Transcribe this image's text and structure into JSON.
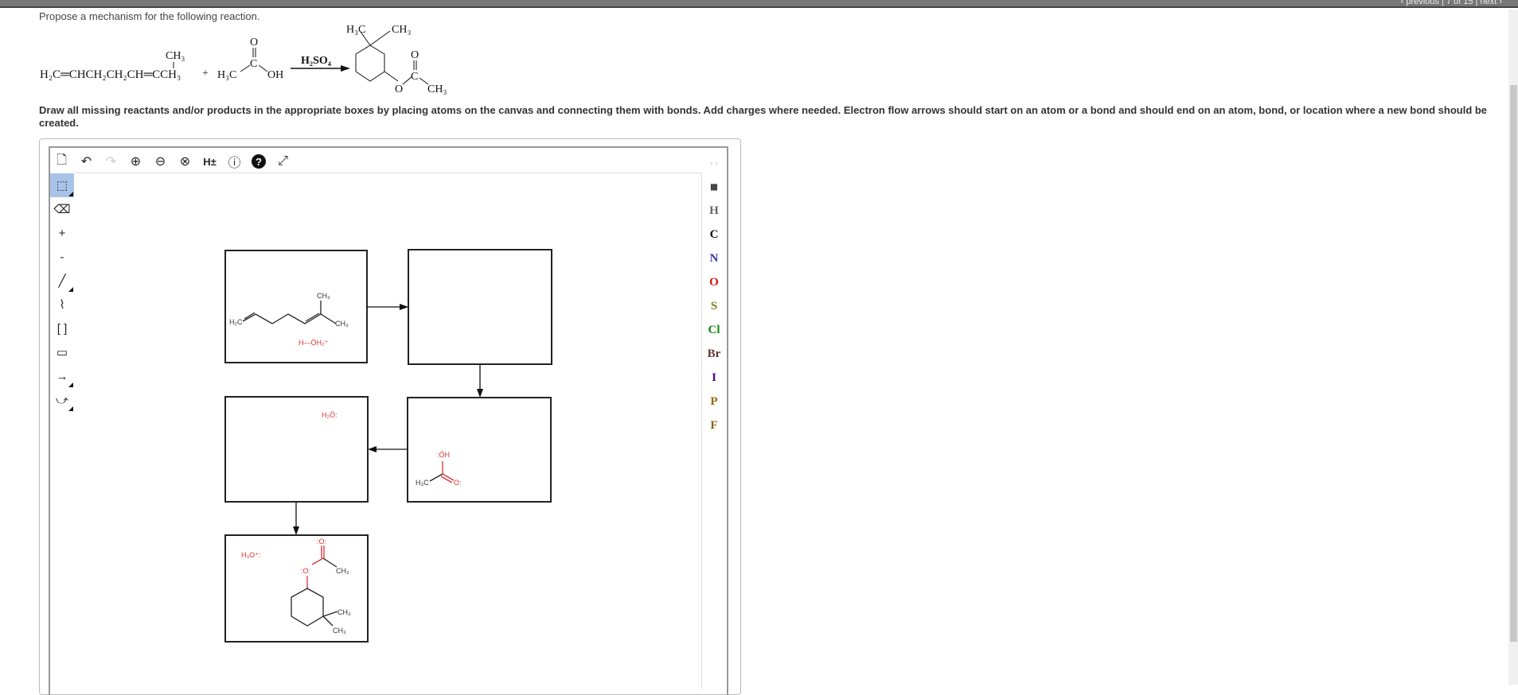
{
  "header": {
    "nav": "‹ previous | 7 of 15 | next ›"
  },
  "question": {
    "prompt": "Propose a mechanism for the following reaction.",
    "reactant1": "H₂C═CHCH₂CH₂CH═CCH₃",
    "reactant1_branch": "CH₃",
    "plus": "+",
    "reactant2_left": "H₃C",
    "reactant2_c": "C",
    "reactant2_o": "O",
    "reactant2_oh": "OH",
    "reagent": "H₂SO₄",
    "product_h3c": "H₃C",
    "product_ch3a": "CH₃",
    "product_o": "O",
    "product_c": "C",
    "product_o_ester": "O",
    "product_ch3b": "CH₃",
    "instructions": "Draw all missing reactants and/or products in the appropriate boxes by placing atoms on the canvas and connecting them with bonds. Add charges where needed. Electron flow arrows should start on an atom or a bond and should end on an atom, bond, or location where a new bond should be created."
  },
  "toolbar": {
    "items": [
      {
        "name": "new-document-icon",
        "glyph": "🗋"
      },
      {
        "name": "undo-icon",
        "glyph": "↶"
      },
      {
        "name": "redo-icon",
        "glyph": "↷"
      },
      {
        "name": "zoom-in-icon",
        "glyph": "⊕"
      },
      {
        "name": "zoom-out-icon",
        "glyph": "⊖"
      },
      {
        "name": "zoom-reset-icon",
        "glyph": "⊗"
      },
      {
        "name": "hydrogen-toggle",
        "glyph": "H±"
      },
      {
        "name": "info-icon",
        "glyph": "ⓘ"
      },
      {
        "name": "help-icon",
        "glyph": "?"
      },
      {
        "name": "fullscreen-icon",
        "glyph": "⤢"
      }
    ]
  },
  "left_tools": [
    {
      "name": "select-tool",
      "glyph": "⬚"
    },
    {
      "name": "eraser-tool",
      "glyph": "⌫"
    },
    {
      "name": "positive-charge-tool",
      "glyph": "+"
    },
    {
      "name": "negative-charge-tool",
      "glyph": "-"
    },
    {
      "name": "bond-tool",
      "glyph": "╱"
    },
    {
      "name": "chain-tool",
      "glyph": "⌇"
    },
    {
      "name": "bracket-tool",
      "glyph": "[ ]"
    },
    {
      "name": "rectangle-tool",
      "glyph": "▭"
    },
    {
      "name": "arrow-tool",
      "glyph": "→"
    },
    {
      "name": "curved-arrow-tool",
      "glyph": "⤻"
    }
  ],
  "palette": {
    "elements": [
      {
        "symbol": "H",
        "color": "#666666"
      },
      {
        "symbol": "C",
        "color": "#111111"
      },
      {
        "symbol": "N",
        "color": "#3333aa"
      },
      {
        "symbol": "O",
        "color": "#dd1111"
      },
      {
        "symbol": "S",
        "color": "#808020"
      },
      {
        "symbol": "Cl",
        "color": "#118811"
      },
      {
        "symbol": "Br",
        "color": "#663333"
      },
      {
        "symbol": "I",
        "color": "#550099"
      },
      {
        "symbol": "P",
        "color": "#996611"
      },
      {
        "symbol": "F",
        "color": "#886611"
      }
    ]
  },
  "canvas": {
    "box1": {
      "h2c": "H₂C",
      "ch3a": "CH₃",
      "ch3b": "CH₃",
      "water": "H—ÖH₂⁺"
    },
    "box3": {
      "water": "H₂Ö:"
    },
    "box4": {
      "oh": ":ÖH",
      "h3c": "H₃C",
      "o": "O:"
    },
    "box5": {
      "hydronium": "H₃O⁺:",
      "o_carbonyl": ":O:",
      "o_ester": ":O:",
      "ch3a": "CH₃",
      "ch3b": "CH₃",
      "ch3c": "CH₃"
    }
  }
}
